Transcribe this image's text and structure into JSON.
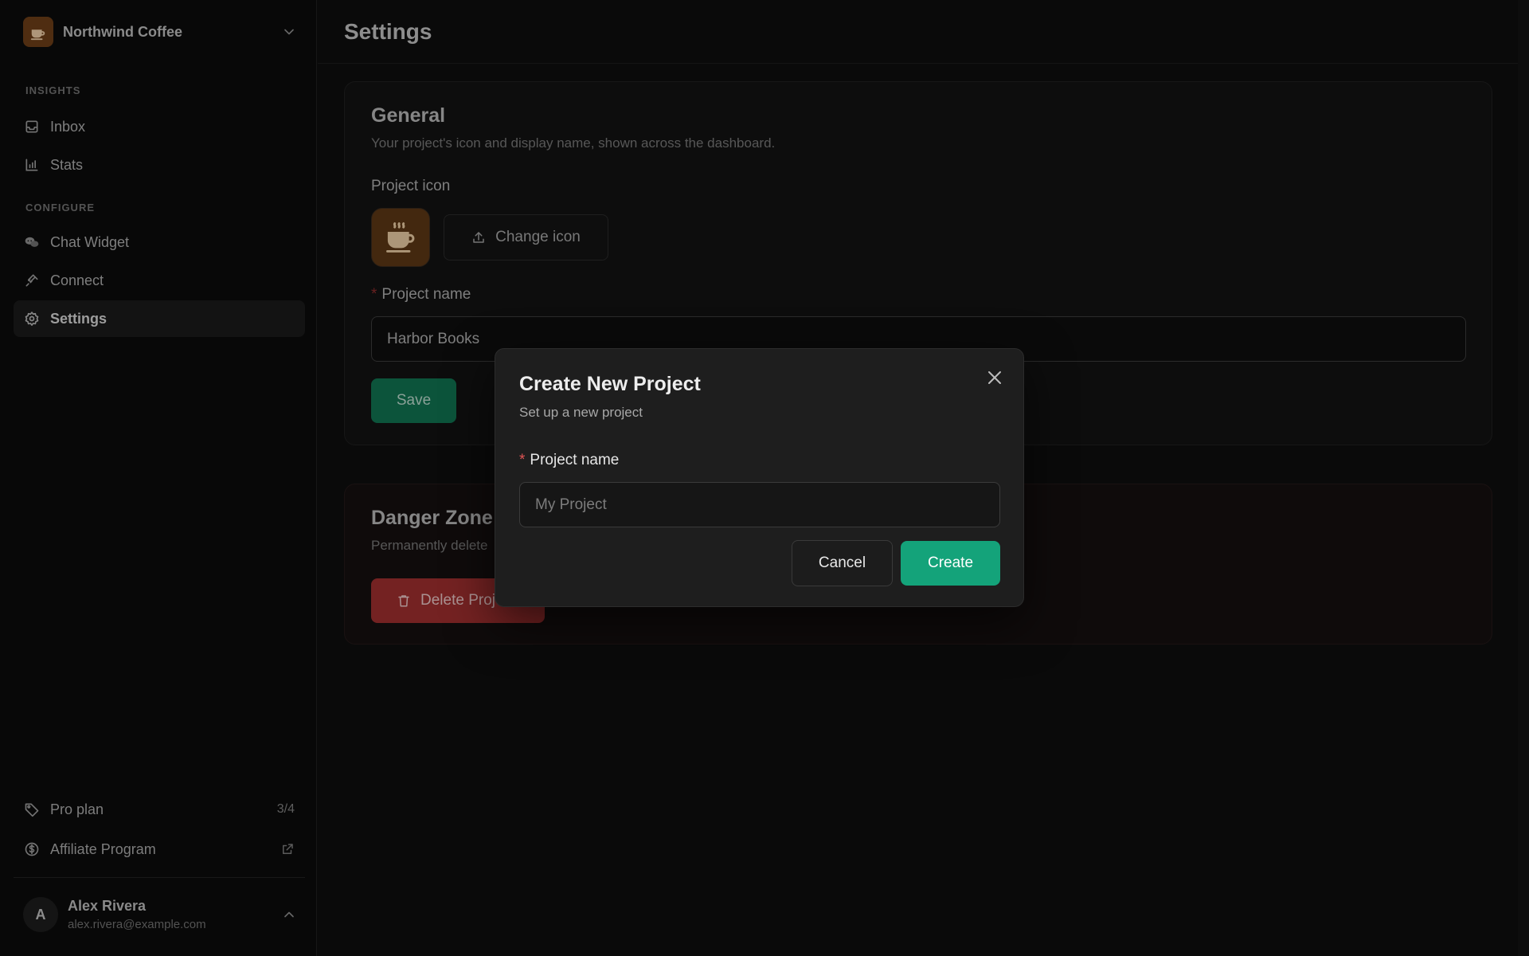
{
  "sidebar": {
    "workspace": {
      "name": "Northwind Coffee",
      "logo_icon": "coffee-cup-icon"
    },
    "sections": [
      {
        "label": "INSIGHTS",
        "items": [
          {
            "label": "Inbox",
            "icon": "inbox-icon"
          },
          {
            "label": "Stats",
            "icon": "bar-chart-icon"
          }
        ]
      },
      {
        "label": "CONFIGURE",
        "items": [
          {
            "label": "Chat Widget",
            "icon": "chat-bubbles-icon"
          },
          {
            "label": "Connect",
            "icon": "plug-icon"
          },
          {
            "label": "Settings",
            "icon": "gear-icon",
            "active": true
          }
        ]
      }
    ],
    "bottom": {
      "plan": {
        "label": "Pro plan",
        "usage": "3/4",
        "icon": "tag-icon"
      },
      "affiliate": {
        "label": "Affiliate Program",
        "icon": "dollar-circle-icon",
        "trailing_icon": "external-link-icon"
      }
    },
    "user": {
      "initial": "A",
      "name": "Alex Rivera",
      "email": "alex.rivera@example.com"
    }
  },
  "main": {
    "title": "Settings",
    "general": {
      "title": "General",
      "description": "Your project's icon and display name, shown across the dashboard.",
      "icon_label": "Project icon",
      "change_icon_label": "Change icon",
      "name_label": "Project name",
      "name_value": "Harbor Books",
      "save_label": "Save"
    },
    "danger": {
      "title": "Danger Zone",
      "description": "Permanently delete",
      "delete_label": "Delete Proj"
    }
  },
  "modal": {
    "title": "Create New Project",
    "subtitle": "Set up a new project",
    "name_label": "Project name",
    "name_placeholder": "My Project",
    "cancel_label": "Cancel",
    "create_label": "Create"
  },
  "colors": {
    "accent": "#14a37a",
    "danger": "#9b2e2e",
    "required": "#e05555",
    "brand_icon_bg": "#6a3d17"
  }
}
